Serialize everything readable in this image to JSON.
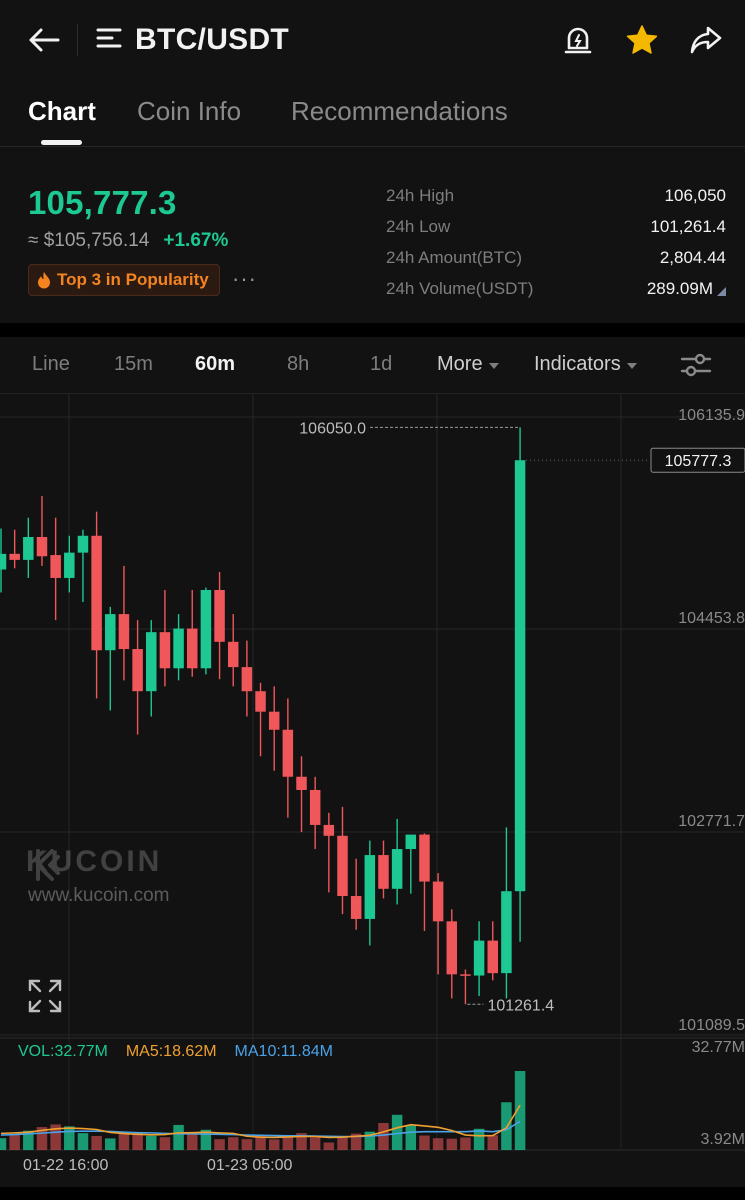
{
  "header": {
    "pair": "BTC/USDT",
    "icons": [
      "back-arrow-icon",
      "menu-icon",
      "price-alert-bell-icon",
      "favorite-star-icon",
      "share-icon"
    ],
    "star_color": "#f5b800"
  },
  "tabs": [
    {
      "label": "Chart",
      "active": true
    },
    {
      "label": "Coin Info",
      "active": false
    },
    {
      "label": "Recommendations",
      "active": false
    }
  ],
  "ticker": {
    "last_price": "105,777.3",
    "fiat_price": "≈ $105,756.14",
    "change": "+1.67%",
    "popularity_badge": "Top 3 in Popularity",
    "more": "···",
    "stats": [
      {
        "label": "24h High",
        "value": "106,050"
      },
      {
        "label": "24h Low",
        "value": "101,261.4"
      },
      {
        "label": "24h Amount(BTC)",
        "value": "2,804.44"
      },
      {
        "label": "24h Volume(USDT)",
        "value": "289.09M"
      }
    ],
    "up_color": "#1dc893",
    "down_color": "#f0575a"
  },
  "timeframes": {
    "items": [
      {
        "label": "Line",
        "active": false
      },
      {
        "label": "15m",
        "active": false
      },
      {
        "label": "60m",
        "active": true
      },
      {
        "label": "8h",
        "active": false
      },
      {
        "label": "1d",
        "active": false
      }
    ],
    "more_label": "More",
    "indicators_label": "Indicators"
  },
  "chart_data": {
    "type": "candlestick",
    "interval": "60m",
    "y_axis_labels": [
      "106135.9",
      "104453.8",
      "102771.7",
      "101089.5"
    ],
    "ylim": [
      101089.5,
      106135.9
    ],
    "current_price_label": "105777.3",
    "high_marker": "106050.0",
    "low_marker": "101261.4",
    "x_labels": [
      "01-22 16:00",
      "01-23 05:00"
    ],
    "candles": [
      {
        "o": 104870,
        "h": 105210,
        "l": 104680,
        "c": 105000
      },
      {
        "o": 105000,
        "h": 105200,
        "l": 104880,
        "c": 104950
      },
      {
        "o": 104950,
        "h": 105300,
        "l": 104800,
        "c": 105140
      },
      {
        "o": 105140,
        "h": 105480,
        "l": 104900,
        "c": 104980
      },
      {
        "o": 104990,
        "h": 105300,
        "l": 104450,
        "c": 104800
      },
      {
        "o": 104800,
        "h": 105150,
        "l": 104680,
        "c": 105010
      },
      {
        "o": 105010,
        "h": 105200,
        "l": 104600,
        "c": 105150
      },
      {
        "o": 105150,
        "h": 105350,
        "l": 103800,
        "c": 104200
      },
      {
        "o": 104200,
        "h": 104560,
        "l": 103700,
        "c": 104500
      },
      {
        "o": 104500,
        "h": 104900,
        "l": 103950,
        "c": 104210
      },
      {
        "o": 104210,
        "h": 104450,
        "l": 103500,
        "c": 103860
      },
      {
        "o": 103860,
        "h": 104450,
        "l": 103650,
        "c": 104350
      },
      {
        "o": 104350,
        "h": 104700,
        "l": 103900,
        "c": 104050
      },
      {
        "o": 104050,
        "h": 104500,
        "l": 103950,
        "c": 104380
      },
      {
        "o": 104380,
        "h": 104700,
        "l": 103980,
        "c": 104050
      },
      {
        "o": 104050,
        "h": 104720,
        "l": 104000,
        "c": 104700
      },
      {
        "o": 104700,
        "h": 104850,
        "l": 103960,
        "c": 104270
      },
      {
        "o": 104270,
        "h": 104500,
        "l": 103900,
        "c": 104060
      },
      {
        "o": 104060,
        "h": 104280,
        "l": 103650,
        "c": 103860
      },
      {
        "o": 103860,
        "h": 103930,
        "l": 103320,
        "c": 103690
      },
      {
        "o": 103690,
        "h": 103900,
        "l": 103200,
        "c": 103540
      },
      {
        "o": 103540,
        "h": 103800,
        "l": 102810,
        "c": 103150
      },
      {
        "o": 103150,
        "h": 103320,
        "l": 102690,
        "c": 103040
      },
      {
        "o": 103040,
        "h": 103150,
        "l": 102550,
        "c": 102750
      },
      {
        "o": 102750,
        "h": 102850,
        "l": 102190,
        "c": 102660
      },
      {
        "o": 102660,
        "h": 102900,
        "l": 102010,
        "c": 102160
      },
      {
        "o": 102160,
        "h": 102470,
        "l": 101880,
        "c": 101970
      },
      {
        "o": 101970,
        "h": 102620,
        "l": 101750,
        "c": 102500
      },
      {
        "o": 102500,
        "h": 102620,
        "l": 102140,
        "c": 102220
      },
      {
        "o": 102220,
        "h": 102800,
        "l": 102090,
        "c": 102550
      },
      {
        "o": 102550,
        "h": 102640,
        "l": 102180,
        "c": 102670
      },
      {
        "o": 102670,
        "h": 102680,
        "l": 101870,
        "c": 102280
      },
      {
        "o": 102280,
        "h": 102350,
        "l": 101510,
        "c": 101950
      },
      {
        "o": 101950,
        "h": 102050,
        "l": 101310,
        "c": 101510
      },
      {
        "o": 101510,
        "h": 101550,
        "l": 101261.4,
        "c": 101500
      },
      {
        "o": 101500,
        "h": 101950,
        "l": 101330,
        "c": 101790
      },
      {
        "o": 101790,
        "h": 101950,
        "l": 101460,
        "c": 101520
      },
      {
        "o": 101520,
        "h": 102730,
        "l": 101310,
        "c": 102200
      },
      {
        "o": 102200,
        "h": 106050,
        "l": 101780,
        "c": 105777.3
      }
    ],
    "volume": {
      "vol_label": "VOL:32.77M",
      "ma5_label": "MA5:18.62M",
      "ma10_label": "MA10:11.84M",
      "axis_top": "32.77M",
      "axis_bottom": "3.92M",
      "values": [
        4.9,
        6.6,
        8.0,
        9.5,
        10.6,
        9.8,
        7.0,
        5.8,
        4.8,
        7.0,
        7.2,
        5.9,
        5.3,
        10.4,
        6.8,
        8.4,
        4.5,
        5.3,
        4.5,
        6.0,
        4.4,
        6.2,
        7.0,
        5.2,
        3.1,
        5.6,
        6.8,
        7.6,
        11.2,
        14.6,
        10.2,
        6.0,
        4.9,
        4.7,
        5.2,
        8.8,
        6.1,
        19.8,
        32.77
      ],
      "ma5": [
        6.9,
        7.1,
        7.4,
        8.1,
        8.8,
        9.1,
        8.9,
        8.5,
        7.3,
        6.8,
        6.5,
        6.3,
        6.4,
        7.1,
        7.2,
        7.4,
        7.1,
        6.9,
        5.7,
        5.3,
        5.2,
        5.4,
        5.6,
        5.6,
        5.2,
        5.3,
        5.7,
        6.1,
        7.5,
        9.2,
        10.5,
        10.0,
        9.4,
        8.1,
        6.2,
        5.9,
        6.0,
        9.2,
        18.62
      ],
      "ma10": [
        6.2,
        6.4,
        6.7,
        7.0,
        7.4,
        7.7,
        7.8,
        7.8,
        7.7,
        7.4,
        7.2,
        7.1,
        6.9,
        6.7,
        6.7,
        6.6,
        6.5,
        6.4,
        6.2,
        6.1,
        6.0,
        5.9,
        5.9,
        5.8,
        5.7,
        5.6,
        5.6,
        5.8,
        6.2,
        6.8,
        7.4,
        7.6,
        7.6,
        7.6,
        7.6,
        7.9,
        7.6,
        8.4,
        11.84
      ]
    },
    "grid": true,
    "watermark": {
      "brand": "KUCOIN",
      "url": "www.kucoin.com"
    }
  }
}
